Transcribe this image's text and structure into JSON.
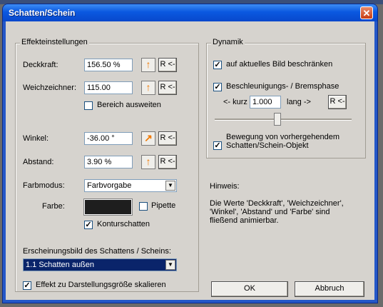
{
  "window": {
    "title": "Schatten/Schein",
    "close_symbol": "✕"
  },
  "effekt": {
    "legend": "Effekteinstellungen",
    "deckkraft": {
      "label": "Deckkraft:",
      "value": "156.50 %"
    },
    "weichzeichner": {
      "label": "Weichzeichner:",
      "value": "115.00"
    },
    "bereich": {
      "label": "Bereich ausweiten",
      "checked": false
    },
    "winkel": {
      "label": "Winkel:",
      "value": "-36.00 °"
    },
    "abstand": {
      "label": "Abstand:",
      "value": "3.90 %"
    },
    "reset_label": "R <-",
    "farbmodus": {
      "label": "Farbmodus:",
      "value": "Farbvorgabe"
    },
    "farbe": {
      "label": "Farbe:",
      "color": "#1e1e1e"
    },
    "pipette": {
      "label": "Pipette",
      "checked": false
    },
    "konturschatten": {
      "label": "Konturschatten",
      "checked": true
    },
    "erscheinung": {
      "label": "Erscheinungsbild des Schattens / Scheins:",
      "value": "1.1 Schatten außen"
    },
    "skalieren": {
      "label": "Effekt zu Darstellungsgröße skalieren",
      "checked": true
    }
  },
  "dynamik": {
    "legend": "Dynamik",
    "beschraenken": {
      "label": "auf aktuelles Bild beschränken",
      "checked": true
    },
    "beschleunigung": {
      "label": "Beschleunigungs- / Bremsphase",
      "checked": true
    },
    "kurz_label": "<- kurz",
    "kurz_value": "1.000",
    "lang_label": "lang ->",
    "reset_label": "R <-",
    "slider_position": 0.46,
    "bewegung": {
      "label": "Bewegung von vorhergehendem Schatten/Schein-Objekt",
      "checked": true
    }
  },
  "hinweis": {
    "title": "Hinweis:",
    "text": "Die Werte 'Deckkraft', 'Weichzeichner', 'Winkel', 'Abstand' und 'Farbe' sind fließend animierbar."
  },
  "buttons": {
    "ok": "OK",
    "cancel": "Abbruch"
  },
  "colors": {
    "titlebar": "#0a58e0",
    "client": "#d6d3ce",
    "arrow": "#f07800",
    "selection": "#0a246a"
  }
}
